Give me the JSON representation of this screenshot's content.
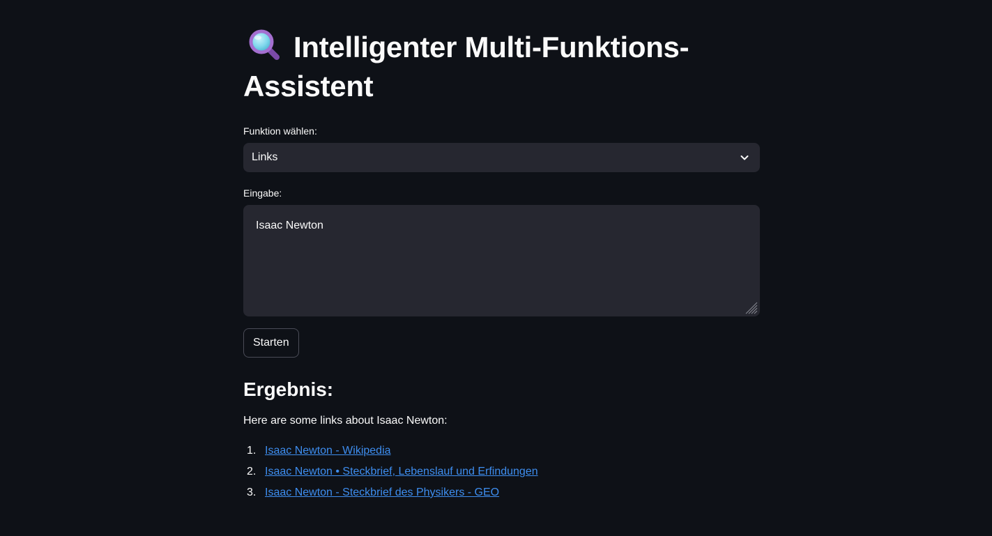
{
  "page": {
    "title": "Intelligenter Multi-Funktions-Assistent",
    "title_icon": "magnifying-glass-icon"
  },
  "function_select": {
    "label": "Funktion wählen:",
    "selected": "Links",
    "icon": "chevron-down-icon"
  },
  "input": {
    "label": "Eingabe:",
    "value": "Isaac Newton"
  },
  "start_button": {
    "label": "Starten"
  },
  "result": {
    "heading": "Ergebnis:",
    "intro": "Here are some links about Isaac Newton:",
    "links": [
      {
        "num": "1.",
        "text": "Isaac Newton - Wikipedia"
      },
      {
        "num": "2.",
        "text": "Isaac Newton • Steckbrief, Lebenslauf und Erfindungen"
      },
      {
        "num": "3.",
        "text": "Isaac Newton - Steckbrief des Physikers - GEO"
      }
    ]
  },
  "colors": {
    "background": "#0e1117",
    "widget_background": "#262730",
    "text": "#fafafa",
    "link": "#3e8ef0"
  }
}
